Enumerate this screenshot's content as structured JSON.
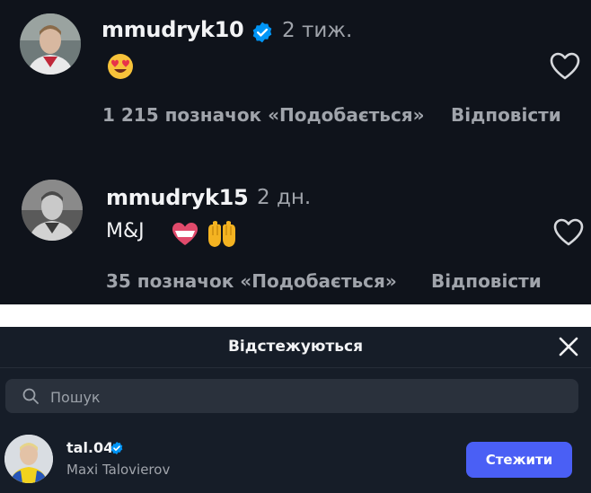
{
  "comments": [
    {
      "username": "mmudryk10",
      "verified": true,
      "time": "2 тиж.",
      "text": "",
      "emoji": [
        "heart-eyes-emoji"
      ],
      "likes": "1 215 позначок «Подобається»",
      "reply": "Відповісти"
    },
    {
      "username": "mmudryk15",
      "verified": false,
      "time": "2 дн.",
      "text": "M&J",
      "emoji": [
        "white-heart-emoji",
        "raised-hands-emoji"
      ],
      "likes": "35 позначок «Подобається»",
      "reply": "Відповісти"
    }
  ],
  "following": {
    "title": "Відстежуються",
    "search": {
      "placeholder": "Пошук",
      "value": ""
    },
    "users": [
      {
        "handle": "tal.04",
        "verified": true,
        "full_name": "Maxi Talovierov",
        "button": "Стежити"
      }
    ]
  },
  "colors": {
    "comments_bg": "#0f131b",
    "following_bg": "#161d28",
    "verified": "#0095f6",
    "follow_button": "#4a5ff5",
    "muted_text": "#a0a4ab"
  }
}
